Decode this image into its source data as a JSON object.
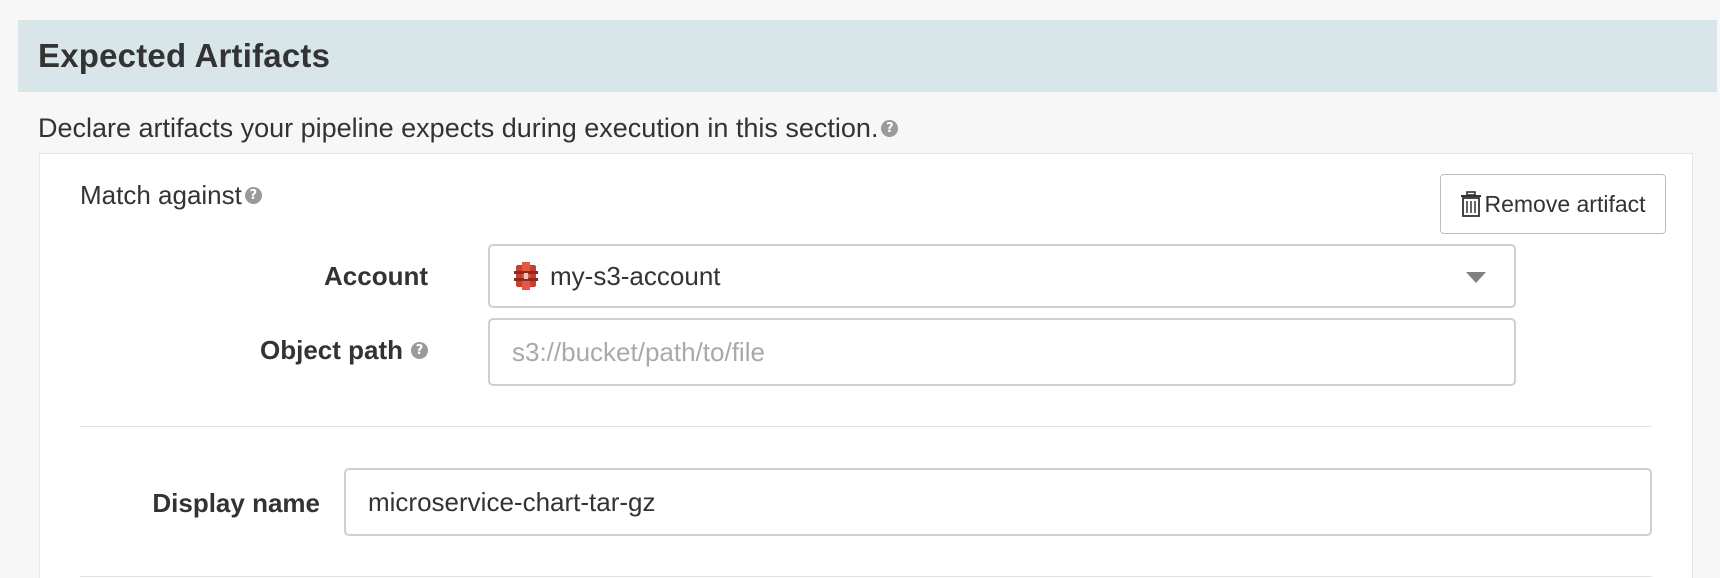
{
  "section": {
    "title": "Expected Artifacts",
    "description": "Declare artifacts your pipeline expects during execution in this section."
  },
  "artifact": {
    "match_label": "Match against",
    "remove_label": "Remove artifact",
    "account": {
      "label": "Account",
      "value": "my-s3-account",
      "icon": "s3-bucket-icon"
    },
    "object_path": {
      "label": "Object path",
      "placeholder": "s3://bucket/path/to/file",
      "value": ""
    },
    "display_name": {
      "label": "Display name",
      "value": "microservice-chart-tar-gz"
    }
  },
  "help_glyph": "?",
  "colors": {
    "header_bg": "#d8e6ea",
    "s3_icon": "#c7402e",
    "page_bg": "#f7f7f7"
  }
}
